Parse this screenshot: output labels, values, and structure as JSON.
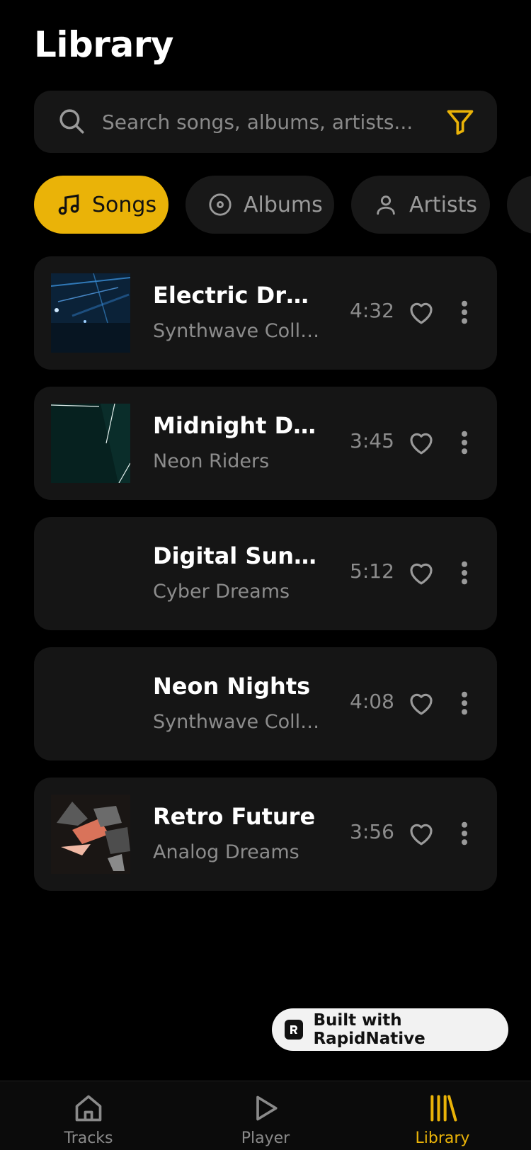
{
  "header": {
    "title": "Library"
  },
  "search": {
    "placeholder": "Search songs, albums, artists..."
  },
  "chips": [
    {
      "label": "Songs",
      "icon": "music-note-icon",
      "active": true
    },
    {
      "label": "Albums",
      "icon": "disc-icon",
      "active": false
    },
    {
      "label": "Artists",
      "icon": "person-icon",
      "active": false
    }
  ],
  "tracks": [
    {
      "title": "Electric Dreams",
      "artist": "Synthwave Collective",
      "duration": "4:32",
      "cover": "concert-lights"
    },
    {
      "title": "Midnight Drive",
      "artist": "Neon Riders",
      "duration": "3:45",
      "cover": "dark-teal-lines"
    },
    {
      "title": "Digital Sunset",
      "artist": "Cyber Dreams",
      "duration": "5:12",
      "cover": "none"
    },
    {
      "title": "Neon Nights",
      "artist": "Synthwave Collective",
      "duration": "4:08",
      "cover": "none"
    },
    {
      "title": "Retro Future",
      "artist": "Analog Dreams",
      "duration": "3:56",
      "cover": "geometric-shapes"
    }
  ],
  "badge": {
    "label": "Built with RapidNative"
  },
  "tabbar": [
    {
      "label": "Tracks",
      "icon": "home-icon",
      "active": false
    },
    {
      "label": "Player",
      "icon": "play-icon",
      "active": false
    },
    {
      "label": "Library",
      "icon": "library-icon",
      "active": true
    }
  ],
  "colors": {
    "accent": "#eab308",
    "background": "#000000",
    "card": "#151515",
    "muted": "#8c8c8c"
  }
}
